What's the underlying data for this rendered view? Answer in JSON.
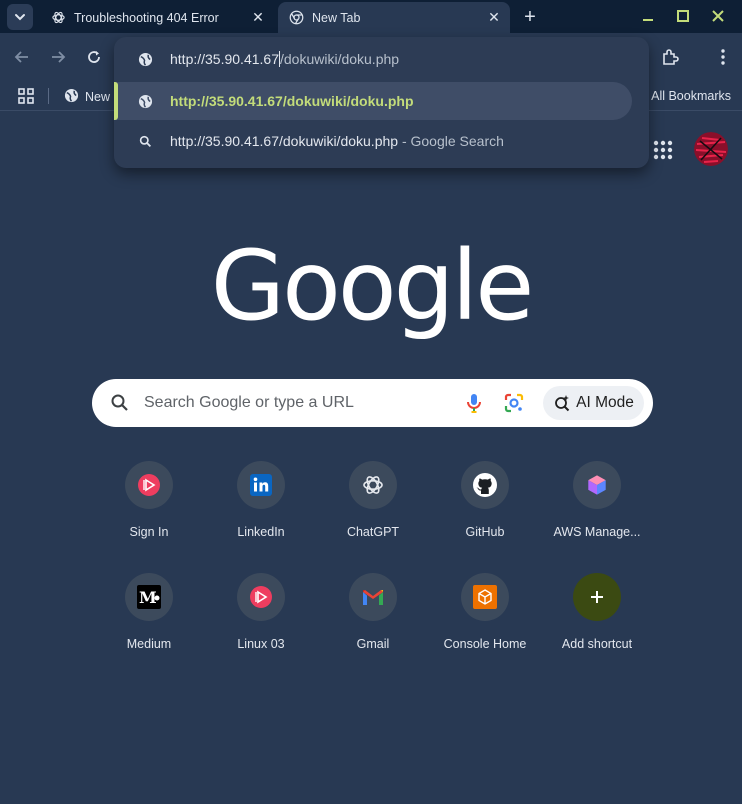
{
  "tabs": [
    {
      "title": "Troubleshooting 404 Error",
      "favicon": "chatgpt-icon",
      "active": false
    },
    {
      "title": "New Tab",
      "favicon": "chrome-icon",
      "active": true
    }
  ],
  "omnibox": {
    "input_host": "http://35.90.41.67",
    "input_path": "/dokuwiki/doku.php",
    "suggestions": [
      {
        "text": "http://35.90.41.67/dokuwiki/doku.php",
        "icon": "globe-icon",
        "selected": true
      },
      {
        "text": "http://35.90.41.67/dokuwiki/doku.php",
        "suffix": " - Google Search",
        "icon": "search-icon",
        "selected": false
      }
    ]
  },
  "bookmarks": {
    "items": [
      {
        "label": "New",
        "icon": "globe-icon"
      }
    ],
    "all_label": "All Bookmarks"
  },
  "ntp": {
    "logo": "Google",
    "search_placeholder": "Search Google or type a URL",
    "ai_mode_label": "AI Mode",
    "shortcuts": [
      {
        "label": "Sign In",
        "icon": "play-icon"
      },
      {
        "label": "LinkedIn",
        "icon": "linkedin-icon"
      },
      {
        "label": "ChatGPT",
        "icon": "chatgpt-icon"
      },
      {
        "label": "GitHub",
        "icon": "github-icon"
      },
      {
        "label": "AWS Manage...",
        "icon": "aws-cube-icon"
      },
      {
        "label": "Medium",
        "icon": "medium-icon"
      },
      {
        "label": "Linux 03",
        "icon": "play-icon"
      },
      {
        "label": "Gmail",
        "icon": "gmail-icon"
      },
      {
        "label": "Console Home",
        "icon": "aws-box-icon"
      },
      {
        "label": "Add shortcut",
        "icon": "plus-icon"
      }
    ]
  },
  "colors": {
    "background": "#283953",
    "tabstrip": "#0e1f35",
    "omnibox": "#2d3c55",
    "selected_text": "#c3dc7a",
    "window_controls": "#c3dc7a"
  }
}
